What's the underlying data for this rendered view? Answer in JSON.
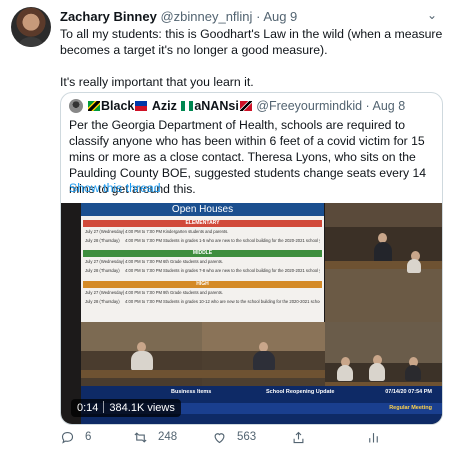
{
  "tweet": {
    "author_name": "Zachary Binney",
    "handle": "@zbinney_nflinj",
    "separator": "·",
    "date": "Aug 9",
    "text_line1": "To all my students: this is Goodhart's Law in the wild (when a measure becomes a target it's no longer a good measure).",
    "text_line2": "It's really important that you learn it."
  },
  "quote": {
    "name_black": "Black",
    "name_aziz": "Aziz",
    "name_nansi": "aNANsi",
    "handle": "@Freeyourmindkid",
    "separator": "·",
    "date": "Aug 8",
    "text": "Per the Georgia Department of Health, schools are required to classify anyone who has been within 6 feet of a covid victim for 15 mins or more as a close contact. Theresa Lyons, who sits on the Paulding County BOE, suggested students change seats every 14 mins to get around this.",
    "show_thread": "Show this thread"
  },
  "media": {
    "slide_title": "Open Houses",
    "bands": {
      "elementary": "ELEMENTARY",
      "middle": "MIDDLE",
      "high": "HIGH"
    },
    "rows": [
      [
        "July 27 (Wednesday)",
        "4:00 PM to 7:00 PM",
        "Kindergarten students and parents."
      ],
      [
        "July 28 (Thursday)",
        "4:00 PM to 7:00 PM",
        "Students in grades 1-5 who are new to the school building for the 2020-2021 school year, and parents"
      ],
      [
        "July 27 (Wednesday)",
        "4:00 PM to 7:00 PM",
        "6th Grade students and parents."
      ],
      [
        "July 28 (Thursday)",
        "4:00 PM to 7:00 PM",
        "Students in grades 7-8 who are new to the school building for the 2020-2021 school year, and parents"
      ],
      [
        "July 27 (Wednesday)",
        "4:00 PM to 7:00 PM",
        "9th Grade students and parents."
      ],
      [
        "July 28 (Thursday)",
        "4:00 PM to 7:00 PM",
        "Students in grades 10-12 who are new to the school building for the 2020-2021 school year, and parents"
      ]
    ],
    "lower_third_left": "Business Items",
    "lower_third_mid": "School Reopening Update",
    "lower_third_datetime": "07/14/20 07:54 PM",
    "lower_third_meeting": "Regular Meeting",
    "elapsed": "0:14",
    "views": "384.1K views"
  },
  "actions": {
    "replies": "6",
    "retweets": "248",
    "likes": "563"
  },
  "icons": {
    "reply": "reply-icon",
    "retweet": "retweet-icon",
    "like": "heart-icon",
    "share": "share-icon",
    "analytics": "analytics-icon",
    "more": "chevron-down-icon"
  },
  "colors": {
    "link": "#1d9bf0",
    "secondary_text": "#536471",
    "border": "#cfd9de"
  }
}
